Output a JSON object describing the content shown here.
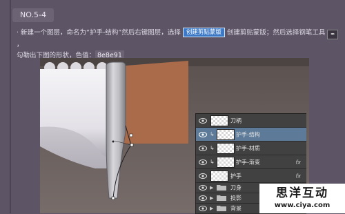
{
  "step_label": "NO.5-4",
  "instruction": {
    "part1": "· 新建一个图层，命名为“护手-结构”然后右键图层，选择",
    "clip_button": "创建剪贴蒙版",
    "part2": "创建剪贴蒙版；然后选择钢笔工具",
    "part3": "，",
    "part4": "勾勒出下图的形状，色值：",
    "color_value": "8e8e91"
  },
  "layers_panel": {
    "layers": [
      {
        "name": "刀柄",
        "clipped": false,
        "fx": false,
        "selected": false
      },
      {
        "name": "护手-结构",
        "clipped": true,
        "fx": false,
        "selected": true
      },
      {
        "name": "护手-材质",
        "clipped": true,
        "fx": false,
        "selected": false
      },
      {
        "name": "护手-渐变",
        "clipped": true,
        "fx": true,
        "selected": false
      },
      {
        "name": "护手",
        "clipped": false,
        "fx": true,
        "selected": false
      }
    ],
    "groups": [
      {
        "name": "刀身"
      },
      {
        "name": "投影"
      },
      {
        "name": "背景"
      }
    ],
    "fx_label": "fx"
  },
  "watermark": {
    "title": "思洋互动",
    "url": "www.ciya.com"
  },
  "colors": {
    "background": "#5d5566",
    "handle": "#a96b4a",
    "blade": "#ececf0",
    "guard": "#8e8e91",
    "selected_layer": "#5d7b98",
    "clip_chip": "#3b78c6"
  }
}
